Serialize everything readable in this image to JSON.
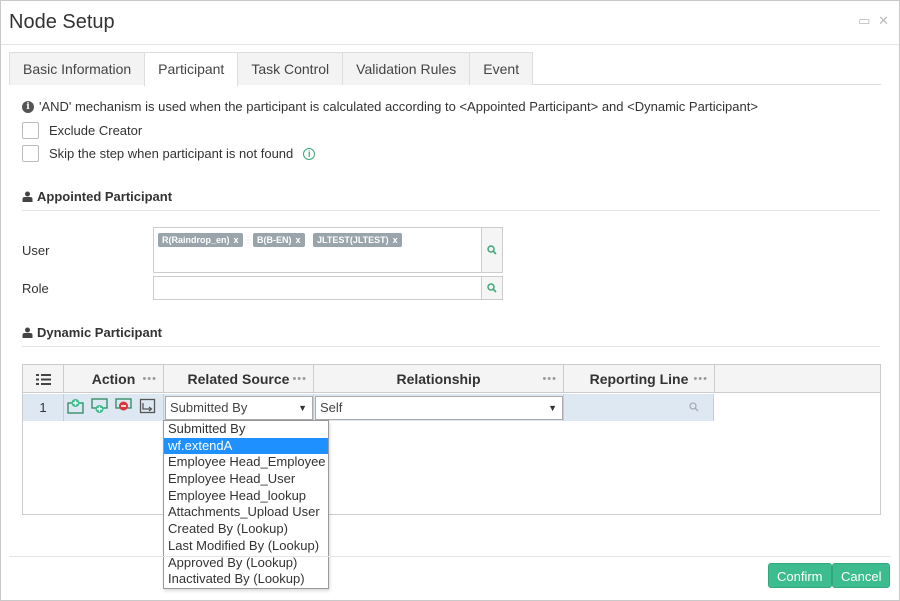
{
  "dialog": {
    "title": "Node Setup",
    "window_buttons": [
      "▭",
      "✕"
    ]
  },
  "tabs": [
    {
      "label": "Basic Information",
      "active": false
    },
    {
      "label": "Participant",
      "active": true
    },
    {
      "label": "Task Control",
      "active": false
    },
    {
      "label": "Validation Rules",
      "active": false
    },
    {
      "label": "Event",
      "active": false
    }
  ],
  "info": {
    "icon": "info-icon",
    "text": "'AND' mechanism is used when the participant is calculated according to <Appointed Participant> and <Dynamic Participant>"
  },
  "options": {
    "exclude_creator": {
      "label": "Exclude Creator",
      "checked": false
    },
    "skip_step": {
      "label": "Skip the step when participant is not found",
      "checked": false,
      "help_icon": "i"
    }
  },
  "appointed": {
    "heading": "Appointed Participant",
    "user_label": "User",
    "user_tags": [
      "R(Raindrop_en)",
      "B(B-EN)",
      "JLTEST(JLTEST)"
    ],
    "tag_remove": "x",
    "role_label": "Role",
    "role_value": ""
  },
  "dynamic": {
    "heading": "Dynamic Participant",
    "columns": {
      "action": "Action",
      "related_source": "Related Source",
      "relationship": "Relationship",
      "reporting_line": "Reporting Line",
      "menu": "•••"
    },
    "rows": [
      {
        "index": "1",
        "related_source": "Submitted By",
        "relationship": "Self",
        "reporting_line": ""
      }
    ],
    "dropdown_options": [
      "Submitted By",
      "wf.extendA",
      "Employee Head_Employee",
      "Employee Head_User",
      "Employee Head_lookup",
      "Attachments_Upload User",
      "Created By (Lookup)",
      "Last Modified By (Lookup)",
      "Approved By (Lookup)",
      "Inactivated By (Lookup)"
    ],
    "dropdown_highlighted": "wf.extendA"
  },
  "footer": {
    "confirm": "Confirm",
    "cancel": "Cancel"
  },
  "colors": {
    "accent_green": "#3dbd8f",
    "row_highlight": "#dde8f2",
    "dropdown_highlight": "#1e90ff"
  }
}
